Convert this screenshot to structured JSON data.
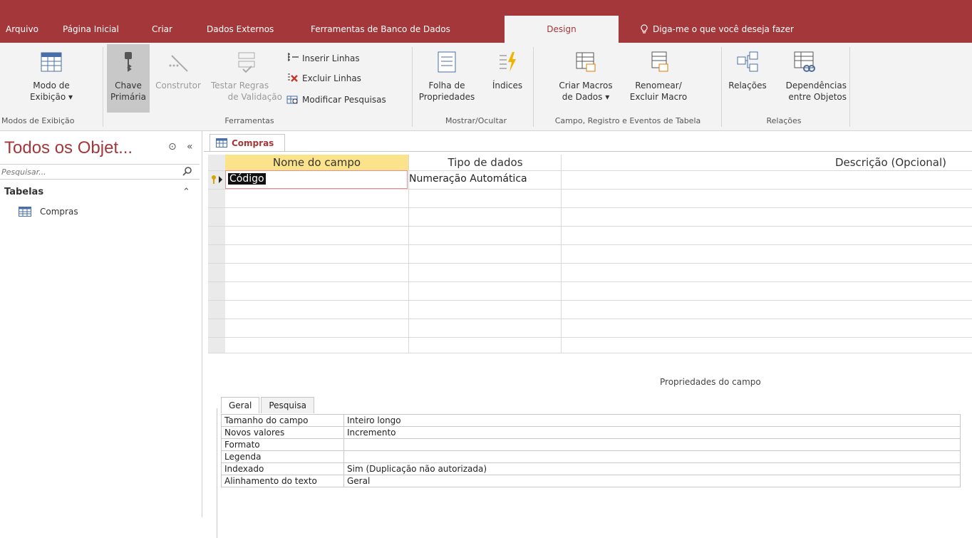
{
  "tabs": [
    {
      "label": "Arquivo"
    },
    {
      "label": "Página Inicial"
    },
    {
      "label": "Criar"
    },
    {
      "label": "Dados Externos"
    },
    {
      "label": "Ferramentas de Banco de Dados"
    },
    {
      "label": "Design"
    }
  ],
  "tell_me": "Diga-me o que você deseja fazer",
  "ribbon": {
    "modo_exibicao": [
      "Modo de",
      "Exibição ▾"
    ],
    "chave_primaria": [
      "Chave",
      "Primária"
    ],
    "construtor": "Construtor",
    "testar_regras": [
      "Testar Regras",
      "de Validação"
    ],
    "inserir_linhas": "Inserir Linhas",
    "excluir_linhas": "Excluir Linhas",
    "modificar_pesquisas": "Modificar Pesquisas",
    "folha_propriedades": [
      "Folha de",
      "Propriedades"
    ],
    "indices": "Índices",
    "criar_macros": [
      "Criar Macros",
      "de Dados ▾"
    ],
    "renomear_macro": [
      "Renomear/",
      "Excluir Macro"
    ],
    "relacoes": "Relações",
    "dependencias": [
      "Dependências",
      "entre Objetos"
    ],
    "groups": {
      "modos": "Modos de Exibição",
      "ferramentas": "Ferramentas",
      "mostrar": "Mostrar/Ocultar",
      "campo": "Campo, Registro e Eventos de Tabela",
      "relacoes": "Relações"
    }
  },
  "nav": {
    "title": "Todos os Objet...",
    "search_placeholder": "Pesquisar...",
    "group": "Tabelas",
    "items": [
      {
        "label": "Compras"
      }
    ]
  },
  "document": {
    "tab": "Compras",
    "columns": [
      "Nome do campo",
      "Tipo de dados",
      "Descrição (Opcional)"
    ],
    "rows": [
      {
        "name": "Código",
        "type": "Numeração Automática",
        "desc": ""
      }
    ]
  },
  "properties": {
    "title": "Propriedades do campo",
    "tabs": [
      "Geral",
      "Pesquisa"
    ],
    "rows": [
      {
        "k": "Tamanho do campo",
        "v": "Inteiro longo"
      },
      {
        "k": "Novos valores",
        "v": "Incremento"
      },
      {
        "k": "Formato",
        "v": ""
      },
      {
        "k": "Legenda",
        "v": ""
      },
      {
        "k": "Indexado",
        "v": "Sim (Duplicação não autorizada)"
      },
      {
        "k": "Alinhamento do texto",
        "v": "Geral"
      }
    ]
  },
  "colors": {
    "accent": "#a4373a",
    "ribbon": "#f3f3f3"
  }
}
